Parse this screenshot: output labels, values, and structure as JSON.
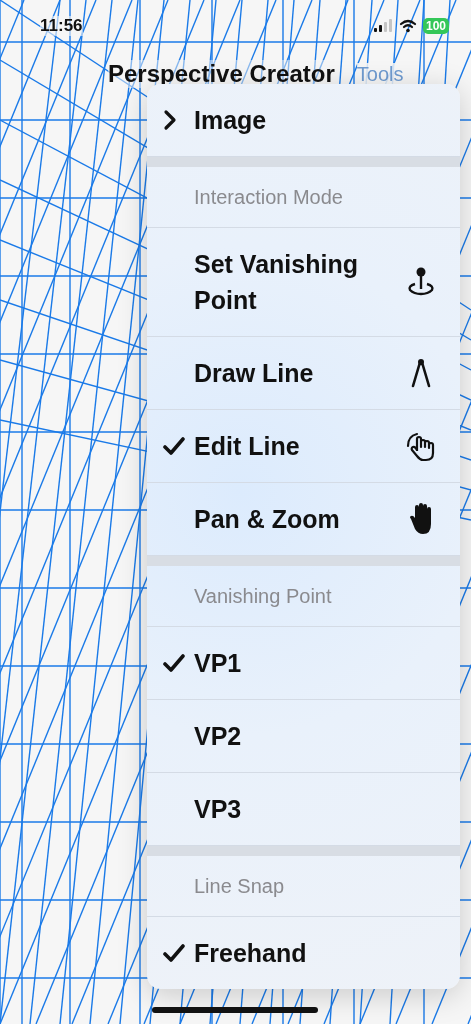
{
  "status_bar": {
    "time": "11:56",
    "battery": "100"
  },
  "nav": {
    "title": "Perspective Creator",
    "tools_button": {
      "label": "Tools",
      "disabled": true
    }
  },
  "menu": {
    "sections": [
      {
        "kind": "plain",
        "items": [
          {
            "label": "Image",
            "kind": "submenu"
          }
        ]
      },
      {
        "kind": "modes",
        "header": "Interaction Mode",
        "items": [
          {
            "label": "Set Vanishing Point",
            "kind": "option",
            "checked": false
          },
          {
            "label": "Draw Line",
            "kind": "option",
            "checked": false
          },
          {
            "label": "Edit Line",
            "kind": "option",
            "checked": true
          },
          {
            "label": "Pan & Zoom",
            "kind": "option",
            "checked": false
          }
        ]
      },
      {
        "kind": "plain",
        "header": "Vanishing Point",
        "items": [
          {
            "label": "VP1",
            "kind": "option",
            "checked": true
          },
          {
            "label": "VP2",
            "kind": "option",
            "checked": false
          },
          {
            "label": "VP3",
            "kind": "option",
            "checked": false
          }
        ]
      },
      {
        "kind": "plain",
        "header": "Line Snap",
        "items": [
          {
            "label": "Freehand",
            "kind": "option",
            "checked": true
          }
        ]
      }
    ]
  }
}
